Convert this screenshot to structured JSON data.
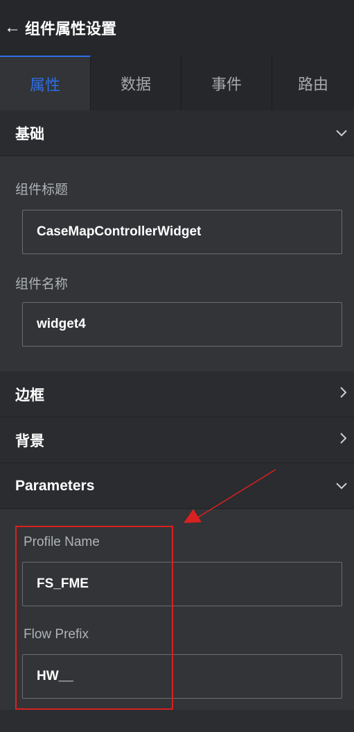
{
  "header": {
    "back_icon": "arrow-left-icon",
    "title": "组件属性设置"
  },
  "tabs": [
    {
      "label": "属性",
      "active": true
    },
    {
      "label": "数据",
      "active": false
    },
    {
      "label": "事件",
      "active": false
    },
    {
      "label": "路由",
      "active": false
    }
  ],
  "sections": {
    "basic": {
      "label": "基础",
      "expanded": true
    },
    "border": {
      "label": "边框",
      "expanded": false
    },
    "background": {
      "label": "背景",
      "expanded": false
    },
    "parameters": {
      "label": "Parameters",
      "expanded": true
    }
  },
  "fields": {
    "component_title": {
      "label": "组件标题",
      "value": "CaseMapControllerWidget"
    },
    "component_name": {
      "label": "组件名称",
      "value": "widget4"
    },
    "profile_name": {
      "label": "Profile Name",
      "value": "FS_FME"
    },
    "flow_prefix": {
      "label": "Flow Prefix",
      "value": "HW__"
    }
  },
  "colors": {
    "accent": "#2f6fe8",
    "annotation": "#d92121",
    "background": "#323437",
    "header": "#25272a"
  }
}
